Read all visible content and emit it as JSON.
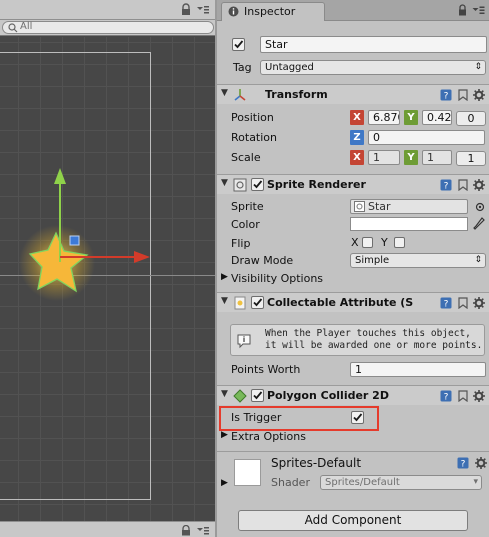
{
  "scene": {
    "search_placeholder": "All"
  },
  "inspector": {
    "tab_label": "Inspector",
    "game_object": {
      "active": true,
      "name": "Star",
      "tag_label": "Tag",
      "tag_value": "Untagged"
    },
    "transform": {
      "title": "Transform",
      "position_label": "Position",
      "position_x": "6.870",
      "position_y": "0.425",
      "position_z": "0",
      "rotation_label": "Rotation",
      "rotation_z": "0",
      "scale_label": "Scale",
      "scale_x": "1",
      "scale_y": "1",
      "scale_z": "1",
      "x_badge": "X",
      "y_badge": "Y",
      "z_badge": "Z"
    },
    "sprite_renderer": {
      "title": "Sprite Renderer",
      "enabled": true,
      "sprite_label": "Sprite",
      "sprite_value": "Star",
      "color_label": "Color",
      "color_value": "#ffffff",
      "flip_label": "Flip",
      "flip_x": "X",
      "flip_y": "Y",
      "draw_mode_label": "Draw Mode",
      "draw_mode_value": "Simple",
      "visibility_label": "Visibility Options"
    },
    "collectable": {
      "title": "Collectable Attribute (S",
      "enabled": true,
      "help_text": "When the Player touches this object, it will be awarded one or more points.",
      "points_label": "Points Worth",
      "points_value": "1"
    },
    "polygon_collider": {
      "title": "Polygon Collider 2D",
      "enabled": true,
      "is_trigger_label": "Is Trigger",
      "is_trigger": true,
      "extra_options_label": "Extra Options"
    },
    "material": {
      "name": "Sprites-Default",
      "shader_label": "Shader",
      "shader_value": "Sprites/Default"
    },
    "add_component_label": "Add Component"
  },
  "colors": {
    "highlight_border": "#e53b2c",
    "x_axis": "#c44534",
    "y_axis": "#6e9c35",
    "z_axis": "#3f78c6"
  }
}
